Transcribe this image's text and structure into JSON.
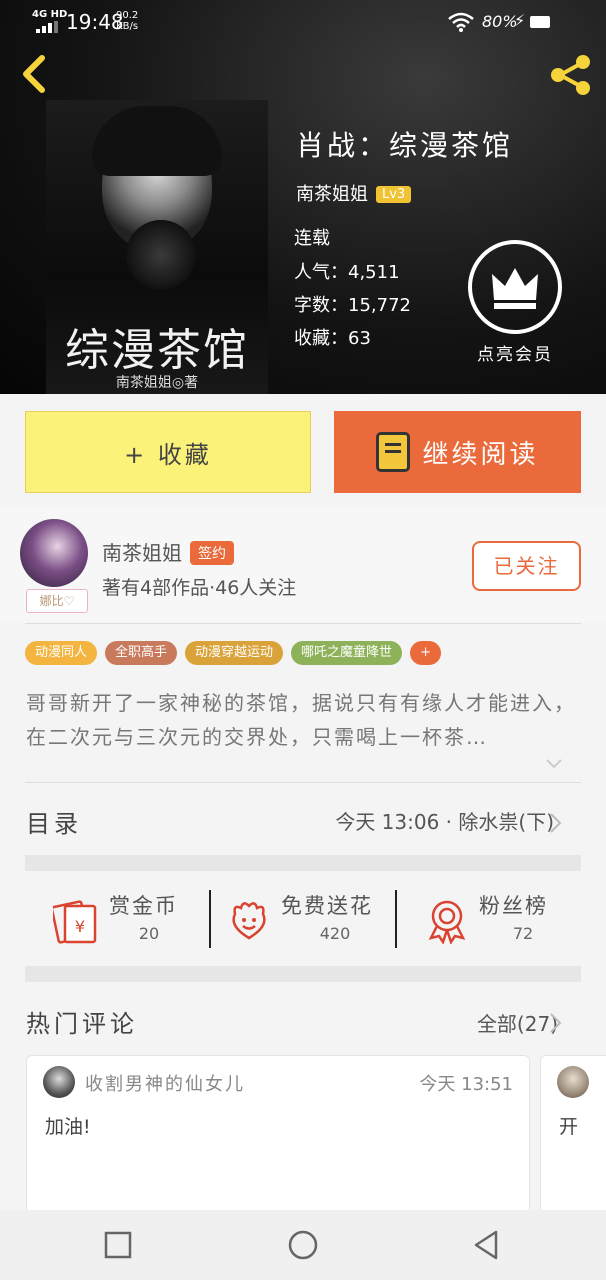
{
  "status_bar": {
    "network": "4G HD",
    "time": "19:48",
    "speed_value": "90.2",
    "speed_unit": "KB/s",
    "battery": "80%"
  },
  "book": {
    "cover_title": "综漫茶馆",
    "cover_author": "南茶姐姐◎著",
    "title": "肖战：综漫茶馆",
    "author": "南茶姐姐",
    "level": "Lv3",
    "status": "连载",
    "popularity_label": "人气：",
    "popularity": "4,511",
    "words_label": "字数：",
    "words": "15,772",
    "favorites_label": "收藏：",
    "favorites": "63"
  },
  "vip": {
    "label": "点亮会员"
  },
  "buttons": {
    "collect": "+ 收藏",
    "continue_reading": "继续阅读",
    "follow": "已关注"
  },
  "author_profile": {
    "name": "南茶姐姐",
    "badge": "签约",
    "meta": "著有4部作品·46人关注",
    "avatar_tag": "娜比♡"
  },
  "tags": [
    {
      "label": "动漫同人",
      "color": "#f3b53f"
    },
    {
      "label": "全职高手",
      "color": "#c97a5d"
    },
    {
      "label": "动漫穿越运动",
      "color": "#d9a33a"
    },
    {
      "label": "哪吒之魔童降世",
      "color": "#8db25a"
    },
    {
      "label": "+",
      "color": "#ea6a3c"
    }
  ],
  "description": "哥哥新开了一家神秘的茶馆，据说只有有缘人才能进入，在二次元与三次元的交界处，只需喝上一杯茶…",
  "toc": {
    "label": "目录",
    "latest": "今天 13:06 · 除水祟(下)"
  },
  "actions": [
    {
      "name": "赏金币",
      "value": "20",
      "icon": "reward-coin-icon"
    },
    {
      "name": "免费送花",
      "value": "420",
      "icon": "flower-icon"
    },
    {
      "name": "粉丝榜",
      "value": "72",
      "icon": "ranking-badge-icon"
    }
  ],
  "comments": {
    "label": "热门评论",
    "all": "全部(27)",
    "items": [
      {
        "user": "收割男神的仙女儿",
        "time": "今天 13:51",
        "text": "加油!"
      },
      {
        "user": "",
        "time": "",
        "text": "开"
      }
    ]
  },
  "colors": {
    "accent": "#ea6a3c",
    "collect_bg": "#fbf27a",
    "level_badge": "#f1c232"
  }
}
